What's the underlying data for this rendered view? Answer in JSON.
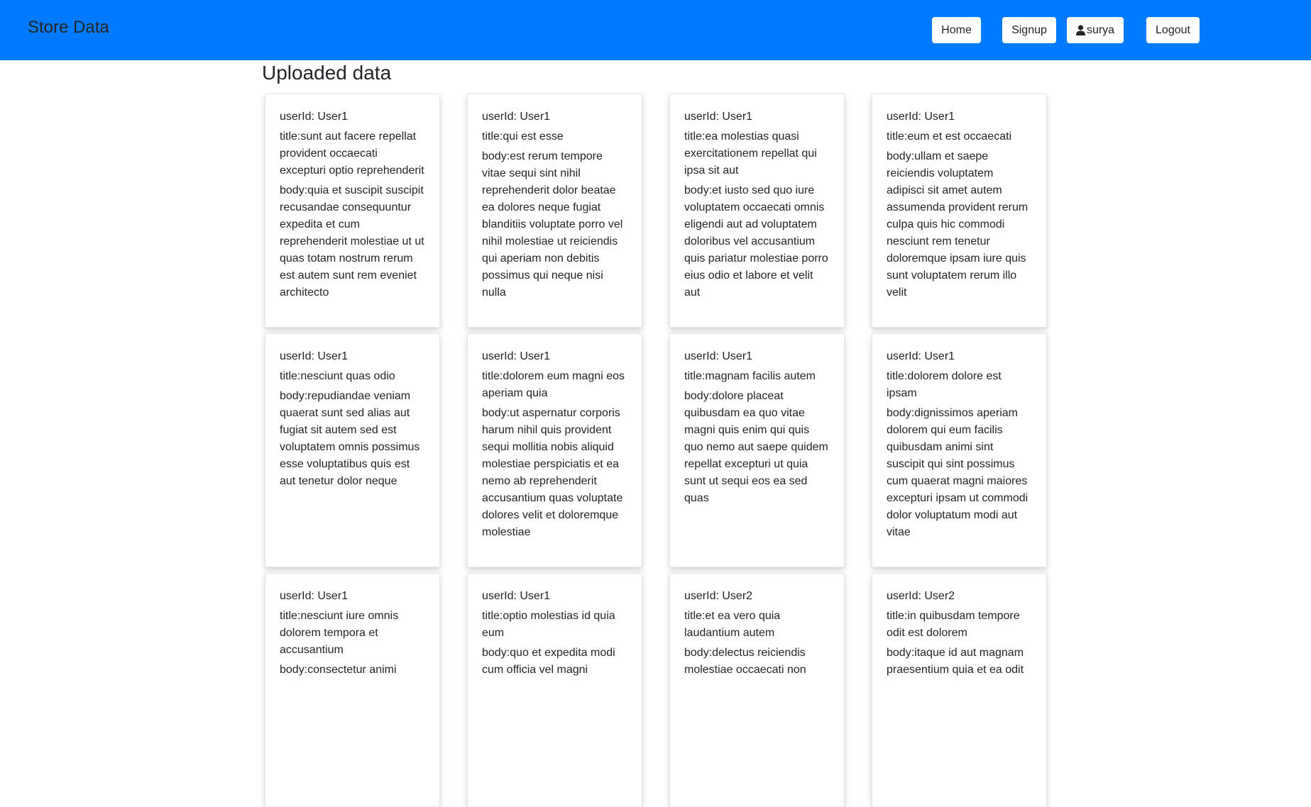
{
  "navbar": {
    "brand": "Store Data",
    "buttons": {
      "home": "Home",
      "signup": "Signup",
      "user": "surya",
      "logout": "Logout"
    },
    "color": "#007bff"
  },
  "page": {
    "title": "Uploaded data"
  },
  "cards": [
    {
      "userId": "userId: User1",
      "title": "title:sunt aut facere repellat provident occaecati excepturi optio reprehenderit",
      "body": "body:quia et suscipit suscipit recusandae consequuntur expedita et cum reprehenderit molestiae ut ut quas totam nostrum rerum est autem sunt rem eveniet architecto"
    },
    {
      "userId": "userId: User1",
      "title": "title:qui est esse",
      "body": "body:est rerum tempore vitae sequi sint nihil reprehenderit dolor beatae ea dolores neque fugiat blanditiis voluptate porro vel nihil molestiae ut reiciendis qui aperiam non debitis possimus qui neque nisi nulla"
    },
    {
      "userId": "userId: User1",
      "title": "title:ea molestias quasi exercitationem repellat qui ipsa sit aut",
      "body": "body:et iusto sed quo iure voluptatem occaecati omnis eligendi aut ad voluptatem doloribus vel accusantium quis pariatur molestiae porro eius odio et labore et velit aut"
    },
    {
      "userId": "userId: User1",
      "title": "title:eum et est occaecati",
      "body": "body:ullam et saepe reiciendis voluptatem adipisci sit amet autem assumenda provident rerum culpa quis hic commodi nesciunt rem tenetur doloremque ipsam iure quis sunt voluptatem rerum illo velit"
    },
    {
      "userId": "userId: User1",
      "title": "title:nesciunt quas odio",
      "body": "body:repudiandae veniam quaerat sunt sed alias aut fugiat sit autem sed est voluptatem omnis possimus esse voluptatibus quis est aut tenetur dolor neque"
    },
    {
      "userId": "userId: User1",
      "title": "title:dolorem eum magni eos aperiam quia",
      "body": "body:ut aspernatur corporis harum nihil quis provident sequi mollitia nobis aliquid molestiae perspiciatis et ea nemo ab reprehenderit accusantium quas voluptate dolores velit et doloremque molestiae"
    },
    {
      "userId": "userId: User1",
      "title": "title:magnam facilis autem",
      "body": "body:dolore placeat quibusdam ea quo vitae magni quis enim qui quis quo nemo aut saepe quidem repellat excepturi ut quia sunt ut sequi eos ea sed quas"
    },
    {
      "userId": "userId: User1",
      "title": "title:dolorem dolore est ipsam",
      "body": "body:dignissimos aperiam dolorem qui eum facilis quibusdam animi sint suscipit qui sint possimus cum quaerat magni maiores excepturi ipsam ut commodi dolor voluptatum modi aut vitae"
    },
    {
      "userId": "userId: User1",
      "title": "title:nesciunt iure omnis dolorem tempora et accusantium",
      "body": "body:consectetur animi"
    },
    {
      "userId": "userId: User1",
      "title": "title:optio molestias id quia eum",
      "body": "body:quo et expedita modi cum officia vel magni"
    },
    {
      "userId": "userId: User2",
      "title": "title:et ea vero quia laudantium autem",
      "body": "body:delectus reiciendis molestiae occaecati non"
    },
    {
      "userId": "userId: User2",
      "title": "title:in quibusdam tempore odit est dolorem",
      "body": "body:itaque id aut magnam praesentium quia et ea odit"
    }
  ]
}
